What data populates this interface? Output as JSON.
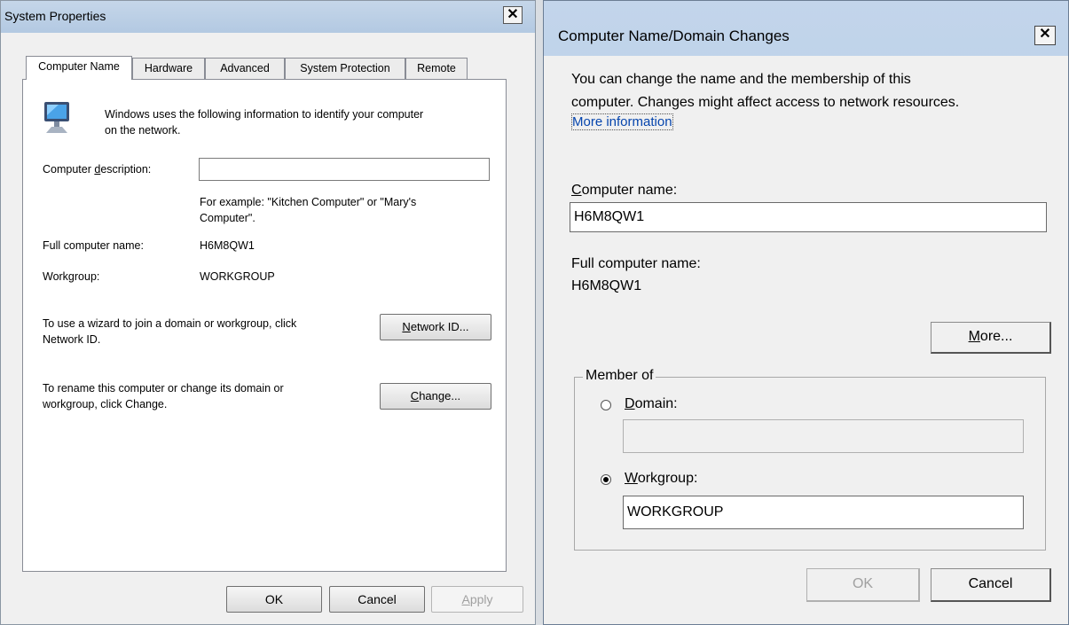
{
  "left_window": {
    "title": "System Properties",
    "close_glyph": "✕",
    "tabs": [
      {
        "label": "Computer Name",
        "selected": true
      },
      {
        "label": "Hardware"
      },
      {
        "label": "Advanced"
      },
      {
        "label": "System Protection"
      },
      {
        "label": "Remote"
      }
    ],
    "intro_line1": "Windows uses the following information to identify your computer",
    "intro_line2": "on the network.",
    "desc_label_pre": "Computer ",
    "desc_label_key": "d",
    "desc_label_post": "escription:",
    "desc_value": "",
    "example_line1": "For example: \"Kitchen Computer\" or \"Mary's",
    "example_line2": "Computer\".",
    "full_name_label": "Full computer name:",
    "full_name_value": "H6M8QW1",
    "workgroup_label": "Workgroup:",
    "workgroup_value": "WORKGROUP",
    "wizard_text_line1": "To use a wizard to join a domain or workgroup, click",
    "wizard_text_line2": "Network ID.",
    "network_btn_key": "N",
    "network_btn_rest": "etwork ID...",
    "rename_text_line1": "To rename this computer or change its domain or",
    "rename_text_line2": "workgroup, click Change.",
    "change_btn_key": "C",
    "change_btn_rest": "hange...",
    "ok_label": "OK",
    "cancel_label": "Cancel",
    "apply_key": "A",
    "apply_rest": "pply"
  },
  "right_window": {
    "title": "Computer Name/Domain Changes",
    "close_glyph": "✕",
    "intro_line1": "You can change the name and the membership of this",
    "intro_line2": "computer. Changes might affect access to network resources.",
    "more_info_link": "More information",
    "name_label_key": "C",
    "name_label_rest": "omputer name:",
    "name_value": "H6M8QW1",
    "full_name_label": "Full computer name:",
    "full_name_value": "H6M8QW1",
    "more_btn_key": "M",
    "more_btn_rest": "ore...",
    "member_of_label": "Member of",
    "domain_key": "D",
    "domain_rest": "omain:",
    "domain_value": "",
    "domain_selected": false,
    "workgroup_key": "W",
    "workgroup_rest": "orkgroup:",
    "workgroup_value": "WORKGROUP",
    "workgroup_selected": true,
    "ok_label": "OK",
    "cancel_label": "Cancel"
  },
  "icons": {
    "computer": "computer-monitor-icon",
    "close": "close-icon"
  },
  "colors": {
    "titlebar": "#b9cde4",
    "link": "#0645ad"
  }
}
